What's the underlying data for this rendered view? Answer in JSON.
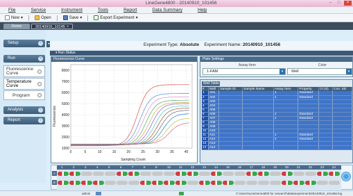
{
  "window": {
    "title": "LineGene4800 - 20140910_101456"
  },
  "menu": [
    "File",
    "Service",
    "Instrument",
    "Tools",
    "Report",
    "Data Summary",
    "Help"
  ],
  "toolbar": {
    "new_label": "New",
    "open_label": "Open",
    "save_label": "Save",
    "export_label": "Export Experiment"
  },
  "tabs": {
    "home": "Home",
    "experiment": "20140910_10145"
  },
  "sidebar": {
    "setup": "Setup",
    "run": "Run",
    "fluorescence": "Fluorescence Curve",
    "temperature": "Temperature Curve",
    "program": "Program",
    "analysis": "Analysis",
    "report": "Report"
  },
  "header": {
    "type_label": "Experiment Type:",
    "type_value": "Absolute",
    "name_label": "Experiment Name:",
    "name_value": "20140910_101456"
  },
  "run_status": "Run Status",
  "fluorescence_panel": {
    "title": "Fluorescence Curve"
  },
  "plate_settings": {
    "title": "Plate Settings",
    "assay_header": "Assay Item",
    "color_header": "Color",
    "assay_value": "1-FAM",
    "color_value": "Well"
  },
  "well_table": {
    "tab": "Well Table",
    "columns": [
      "#",
      "Well",
      "Sample ID",
      "Sample Name",
      "Assay Item",
      "Property",
      "Ct (S)",
      "Con. SD"
    ],
    "rows": [
      [
        "1",
        "A01",
        "",
        "",
        "1",
        "Standard",
        "",
        ""
      ],
      [
        "2",
        "A02",
        "",
        "",
        "1",
        "Standard",
        "",
        ""
      ],
      [
        "3",
        "A03",
        "",
        "",
        "",
        "",
        "",
        ""
      ],
      [
        "4",
        "A04",
        "",
        "",
        "",
        "",
        "",
        ""
      ],
      [
        "5",
        "A05",
        "",
        "",
        "",
        "",
        "",
        ""
      ],
      [
        "6",
        "A06",
        "",
        "",
        "1",
        "Standard",
        "",
        ""
      ],
      [
        "7",
        "A07",
        "",
        "",
        "1",
        "Standard",
        "",
        ""
      ],
      [
        "8",
        "A08",
        "",
        "",
        "",
        "",
        "",
        ""
      ],
      [
        "9",
        "A09",
        "",
        "",
        "",
        "",
        "",
        ""
      ],
      [
        "10",
        "A10",
        "",
        "",
        "",
        "",
        "",
        ""
      ],
      [
        "11",
        "A11",
        "",
        "",
        "1",
        "Standard",
        "",
        ""
      ],
      [
        "12",
        "A12",
        "",
        "",
        "1",
        "Standard",
        "",
        ""
      ],
      [
        "13",
        "A13",
        "",
        "",
        "",
        "",
        "",
        ""
      ],
      [
        "14",
        "A14",
        "",
        "",
        "",
        "",
        "",
        ""
      ]
    ]
  },
  "plate": {
    "columns": [
      "1",
      "2",
      "3",
      "4",
      "5",
      "6",
      "7",
      "8",
      "9",
      "10",
      "11",
      "12",
      "13",
      "14",
      "15",
      "16",
      "17",
      "18",
      "19",
      "20",
      "21",
      "22",
      "23",
      "24"
    ],
    "rows": [
      "A",
      "B"
    ],
    "filled_A": [
      1,
      2,
      6,
      7,
      11,
      12,
      14,
      17,
      18,
      20,
      23,
      24
    ],
    "filled_B": [
      1,
      2,
      3,
      4,
      8,
      9,
      10,
      11,
      13,
      14,
      15,
      20,
      21,
      22
    ]
  },
  "status": {
    "user": "admin",
    "path": "C:\\Users\\LineGene4800 for research\\data\\experiment\\20140910_101456.lng"
  },
  "chart_data": {
    "type": "line",
    "title": "",
    "xlabel": "Sampling Count",
    "ylabel": "Fluorescence",
    "xlim": [
      0,
      42
    ],
    "ylim": [
      1000,
      8500
    ],
    "xticks": [
      0,
      5,
      10,
      15,
      20,
      25,
      30,
      35,
      40
    ],
    "yticks": [
      1000,
      2000,
      3000,
      4000,
      5000,
      6000,
      7000,
      8000
    ],
    "grid": true,
    "series": [
      {
        "color": "#d84a4a",
        "midpoint": 23,
        "max": 6700
      },
      {
        "color": "#4a8fd8",
        "midpoint": 24,
        "max": 5900
      },
      {
        "color": "#e08ad0",
        "midpoint": 25,
        "max": 5600
      },
      {
        "color": "#47b06a",
        "midpoint": 26,
        "max": 5300
      },
      {
        "color": "#d8a64a",
        "midpoint": 27,
        "max": 5100
      },
      {
        "color": "#8a5ad8",
        "midpoint": 28,
        "max": 5000
      },
      {
        "color": "#4ac7c7",
        "midpoint": 29,
        "max": 4800
      },
      {
        "color": "#a0522d",
        "midpoint": 30,
        "max": 4600
      },
      {
        "color": "#6a6a6a",
        "midpoint": 31,
        "max": 4400
      },
      {
        "color": "#1e7fd8",
        "midpoint": 32,
        "max": 4100
      },
      {
        "color": "#c0c040",
        "midpoint": 33,
        "max": 3700
      },
      {
        "color": "#e06090",
        "midpoint": 34,
        "max": 3300
      }
    ]
  }
}
